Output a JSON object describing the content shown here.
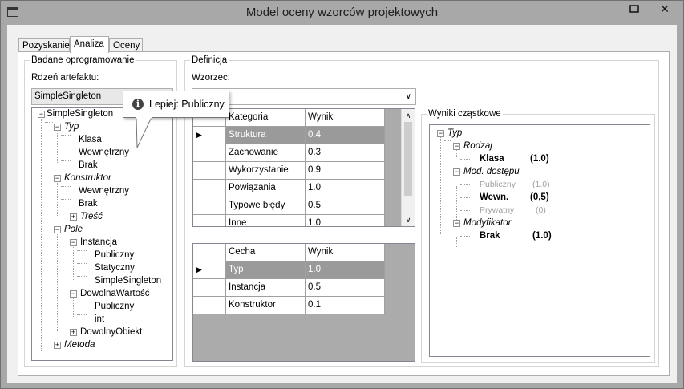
{
  "window": {
    "title": "Model oceny wzorców projektowych",
    "minimize": "—",
    "maximize": "☐",
    "close": "✕"
  },
  "tabs": [
    "Pozyskanie",
    "Analiza",
    "Oceny"
  ],
  "left_group": {
    "title": "Badane oprogramowanie",
    "core_label": "Rdzeń artefaktu:",
    "core_value": "SimpleSingleton",
    "tree": {
      "root": "SimpleSingleton",
      "typ": "Typ",
      "klasa": "Klasa",
      "wewnetrzny": "Wewnętrzny",
      "brak": "Brak",
      "konstruktor": "Konstruktor",
      "k_wewnetrzny": "Wewnętrzny",
      "k_brak": "Brak",
      "tresc": "Treść",
      "pole": "Pole",
      "instancja": "Instancja",
      "publiczny": "Publiczny",
      "statyczny": "Statyczny",
      "simplesingleton": "SimpleSingleton",
      "dowolna": "DowolnaWartość",
      "d_publiczny": "Publiczny",
      "int": "int",
      "dowolny_obiekt": "DowolnyObiekt",
      "metoda": "Metoda"
    }
  },
  "tooltip": {
    "text": "Lepiej: Publiczny",
    "icon": "info-icon"
  },
  "definition": {
    "title": "Definicja",
    "pattern_label": "Wzorzec:",
    "pattern_value": ""
  },
  "grid1": {
    "headers": [
      "Kategoria",
      "Wynik"
    ],
    "rows": [
      [
        "Struktura",
        "0.4"
      ],
      [
        "Zachowanie",
        "0.3"
      ],
      [
        "Wykorzystanie",
        "0.9"
      ],
      [
        "Powiązania",
        "1.0"
      ],
      [
        "Typowe błędy",
        "0.5"
      ],
      [
        "Inne",
        "1.0"
      ]
    ]
  },
  "grid2": {
    "headers": [
      "Cecha",
      "Wynik"
    ],
    "rows": [
      [
        "Typ",
        "1.0"
      ],
      [
        "Instancja",
        "0.5"
      ],
      [
        "Konstruktor",
        "0.1"
      ]
    ]
  },
  "partial": {
    "title": "Wyniki cząstkowe",
    "typ": "Typ",
    "rodzaj": "Rodzaj",
    "klasa": "Klasa",
    "klasa_score": "(1.0)",
    "mod": "Mod. dostępu",
    "publiczny": "Publiczny",
    "publiczny_score": "(1.0)",
    "wewn": "Wewn.",
    "wewn_score": "(0,5)",
    "prywatny": "Prywatny",
    "prywatny_score": "(0)",
    "modyfikator": "Modyfikator",
    "brak": "Brak",
    "brak_score": "(1.0)"
  }
}
